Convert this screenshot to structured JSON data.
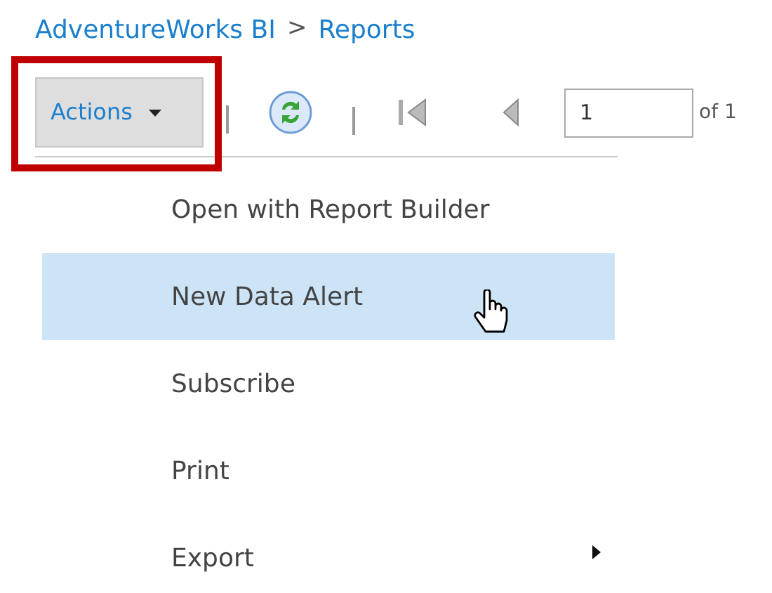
{
  "breadcrumb": [
    {
      "label": "AdventureWorks BI"
    },
    {
      "label": "Reports"
    }
  ],
  "breadcrumb_separator": ">",
  "toolbar": {
    "actions_button": {
      "label": "Actions",
      "highlighted": true
    },
    "page_field": {
      "value": "1"
    },
    "page_count": "of 1"
  },
  "menu": [
    {
      "label": "Open with Report Builder",
      "selected": false,
      "submenu": false
    },
    {
      "label": "New Data Alert",
      "selected": true,
      "submenu": false
    },
    {
      "label": "Subscribe",
      "selected": false,
      "submenu": false
    },
    {
      "label": "Print",
      "selected": false,
      "submenu": false
    },
    {
      "label": "Export",
      "selected": false,
      "submenu": true
    }
  ]
}
